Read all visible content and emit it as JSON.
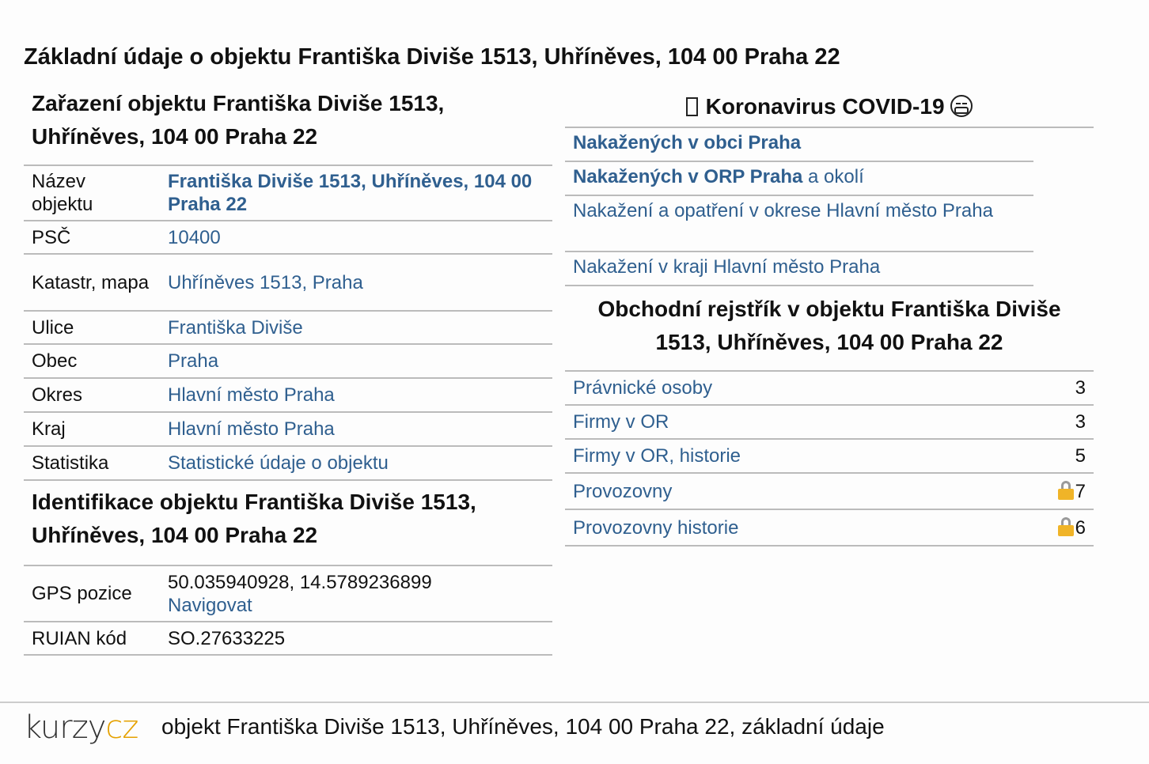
{
  "title": "Základní údaje o objektu Františka Diviše 1513, Uhříněves, 104 00 Praha 22",
  "classification": {
    "title": "Zařazení objektu Františka Diviše 1513, Uhříněves, 104 00 Praha 22",
    "rows": [
      {
        "label": "Název objektu",
        "value": "Františka Diviše 1513, Uhříněves, 104 00 Praha 22",
        "bold": true
      },
      {
        "label": "PSČ",
        "value": "10400"
      },
      {
        "label": "Katastr, mapa",
        "value": "Uhříněves 1513, Praha"
      },
      {
        "label": "Ulice",
        "value": "Františka Diviše"
      },
      {
        "label": "Obec",
        "value": "Praha"
      },
      {
        "label": "Okres",
        "value": "Hlavní město Praha"
      },
      {
        "label": "Kraj",
        "value": "Hlavní město Praha"
      },
      {
        "label": "Statistika",
        "value": "Statistické údaje o objektu"
      }
    ]
  },
  "identification": {
    "title": "Identifikace objektu Františka Diviše 1513, Uhříněves, 104 00 Praha 22",
    "gps_label": "GPS pozice",
    "gps_value": "50.035940928, 14.5789236899",
    "navigate": "Navigovat",
    "ruian_label": "RUIAN kód",
    "ruian_value": "SO.27633225"
  },
  "covid": {
    "title": "Koronavirus COVID-19",
    "icons": [
      "box-glyph-icon",
      "face-mask-icon"
    ],
    "links": {
      "obec": "Nakažených v obci Praha",
      "orp_bold": "Nakažených v ORP Praha",
      "orp_rest": " a okolí",
      "okres": "Nakažení a opatření v okrese Hlavní město Praha",
      "kraj": "Nakažení v kraji Hlavní město Praha"
    }
  },
  "business": {
    "title": "Obchodní rejstřík v objektu Františka Diviše 1513, Uhříněves, 104 00 Praha 22",
    "rows": [
      {
        "label": "Právnické osoby",
        "value": "3",
        "locked": false
      },
      {
        "label": "Firmy v OR",
        "value": "3",
        "locked": false
      },
      {
        "label": "Firmy v OR, historie",
        "value": "5",
        "locked": false
      },
      {
        "label": "Provozovny",
        "value": "7",
        "locked": true
      },
      {
        "label": "Provozovny historie",
        "value": "6",
        "locked": true
      }
    ]
  },
  "footer": {
    "logo_part1": "kurzy",
    "logo_part2": "cz",
    "text": "objekt Františka Diviše 1513, Uhříněves, 104 00 Praha 22, základní údaje"
  },
  "colors": {
    "link": "#2f5f8f",
    "logo_accent": "#e5a100",
    "lock": "#f0b428",
    "border": "#bbbbbb"
  }
}
